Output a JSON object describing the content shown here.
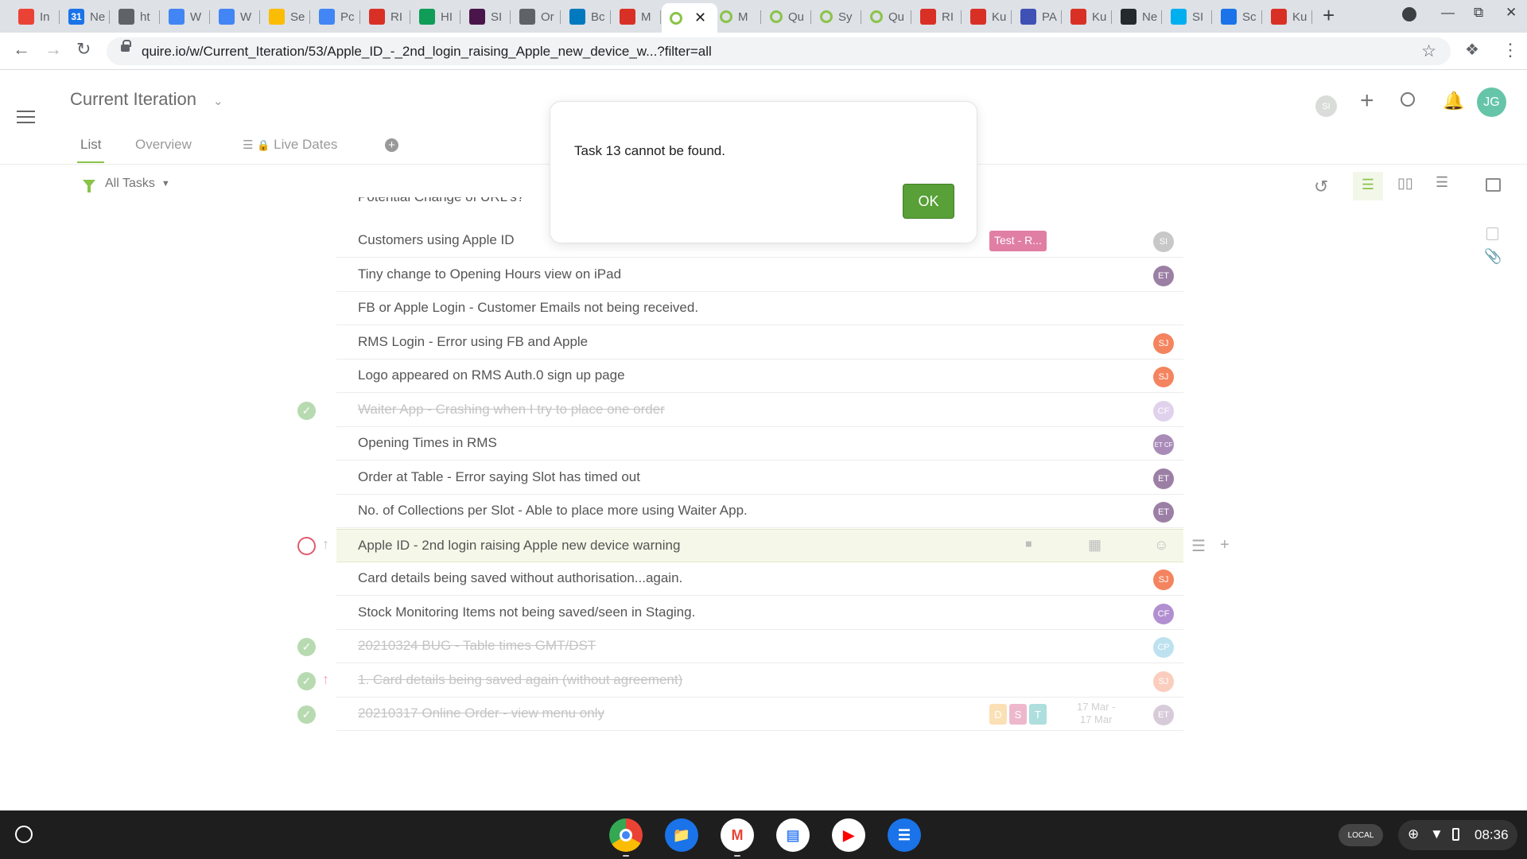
{
  "browser": {
    "tabs": [
      {
        "label": "In",
        "icon": "gmail-icon",
        "color": "#ea4335"
      },
      {
        "label": "Ne",
        "icon": "calendar-icon",
        "color": "#1a73e8",
        "glyph": "31"
      },
      {
        "label": "ht",
        "icon": "globe-icon",
        "color": "#5f6368"
      },
      {
        "label": "W",
        "icon": "docs-icon",
        "color": "#4285f4"
      },
      {
        "label": "W",
        "icon": "docs-icon",
        "color": "#4285f4"
      },
      {
        "label": "Se",
        "icon": "drive-icon",
        "color": "#fbbc04"
      },
      {
        "label": "Pc",
        "icon": "docs-icon",
        "color": "#4285f4"
      },
      {
        "label": "RI",
        "icon": "quire-red-icon",
        "color": "#d93025"
      },
      {
        "label": "HI",
        "icon": "sheets-plus-icon",
        "color": "#0f9d58"
      },
      {
        "label": "SI",
        "icon": "slack-icon",
        "color": "#4a154b"
      },
      {
        "label": "Or",
        "icon": "globe-icon",
        "color": "#5f6368"
      },
      {
        "label": "Bc",
        "icon": "trello-icon",
        "color": "#0079bf"
      },
      {
        "label": "M",
        "icon": "m-dots-icon",
        "color": "#d93025"
      },
      {
        "label": "",
        "icon": "quire-icon",
        "color": "#8bc34a",
        "active": true
      },
      {
        "label": "M",
        "icon": "quire-icon",
        "color": "#8bc34a"
      },
      {
        "label": "Qu",
        "icon": "quire-icon",
        "color": "#8bc34a"
      },
      {
        "label": "Sy",
        "icon": "quire-icon",
        "color": "#8bc34a"
      },
      {
        "label": "Qu",
        "icon": "quire-icon",
        "color": "#8bc34a"
      },
      {
        "label": "RI",
        "icon": "quire-red-icon",
        "color": "#d93025"
      },
      {
        "label": "Ku",
        "icon": "quire-red-icon",
        "color": "#d93025"
      },
      {
        "label": "PA",
        "icon": "pa-icon",
        "color": "#3f51b5"
      },
      {
        "label": "Ku",
        "icon": "quire-red-icon",
        "color": "#d93025"
      },
      {
        "label": "Ne",
        "icon": "github-icon",
        "color": "#24292e"
      },
      {
        "label": "SI",
        "icon": "skype-icon",
        "color": "#00aff0"
      },
      {
        "label": "Sc",
        "icon": "puzzle-blue-icon",
        "color": "#1a73e8"
      },
      {
        "label": "Ku",
        "icon": "quire-red-icon",
        "color": "#d93025"
      }
    ],
    "url": "quire.io/w/Current_Iteration/53/Apple_ID_-_2nd_login_raising_Apple_new_device_w...?filter=all"
  },
  "app": {
    "project_title": "Current Iteration",
    "view_tabs": {
      "list": "List",
      "overview": "Overview",
      "live_dates": "Live Dates"
    },
    "filter_label": "All Tasks",
    "header_avatar_small": "SI",
    "user_avatar": "JG",
    "partial_row_text": "Potential Change of URL's?",
    "tasks": [
      {
        "name": "Customers using Apple ID",
        "done": false,
        "tag": "Test - R...",
        "avatar": "SI",
        "avatar_color": "#c8c8c8"
      },
      {
        "name": "Tiny change to Opening Hours view on iPad",
        "done": false,
        "avatar": "ET",
        "avatar_color": "#9c7fa5"
      },
      {
        "name": "FB or Apple Login - Customer Emails not being received.",
        "done": false
      },
      {
        "name": "RMS Login - Error using FB and Apple",
        "done": false,
        "avatar": "SJ",
        "avatar_color": "#f4845f"
      },
      {
        "name": "Logo appeared on RMS Auth.0 sign up page",
        "done": false,
        "avatar": "SJ",
        "avatar_color": "#f4845f"
      },
      {
        "name": "Waiter App - Crashing when I try to place one order",
        "done": true,
        "avatar": "CF",
        "avatar_color": "#b28fd0"
      },
      {
        "name": "Opening Times in RMS",
        "done": false,
        "avatar": "ET CF",
        "avatar_color": "#a98bb8"
      },
      {
        "name": "Order at Table - Error saying Slot has timed out",
        "done": false,
        "avatar": "ET",
        "avatar_color": "#9c7fa5"
      },
      {
        "name": "No. of Collections per Slot - Able to place more using Waiter App.",
        "done": false,
        "avatar": "ET",
        "avatar_color": "#9c7fa5"
      },
      {
        "name": "Apple ID - 2nd login raising Apple new device warning",
        "done": false,
        "active": true
      },
      {
        "name": "Card details being saved without authorisation...again.",
        "done": false,
        "avatar": "SJ",
        "avatar_color": "#f4845f"
      },
      {
        "name": "Stock Monitoring Items not being saved/seen in Staging.",
        "done": false,
        "avatar": "CF",
        "avatar_color": "#b28fd0"
      },
      {
        "name": "20210324 BUG - Table times GMT/DST",
        "done": true,
        "avatar": "CP",
        "avatar_color": "#5db6d8"
      },
      {
        "name": "1. Card details being saved again (without agreement)",
        "done": true,
        "avatar": "SJ",
        "avatar_color": "#f4845f"
      },
      {
        "name": "20210317 Online Order - view menu only",
        "done": true,
        "avatar": "ET",
        "avatar_color": "#9c7fa5",
        "chips": [
          "D",
          "S",
          "T"
        ],
        "dates": [
          "17 Mar -",
          "17 Mar"
        ]
      }
    ]
  },
  "dialog": {
    "message": "Task 13 cannot be found.",
    "ok_label": "OK"
  },
  "system": {
    "clock": "08:36",
    "local_label": "LOCAL"
  }
}
